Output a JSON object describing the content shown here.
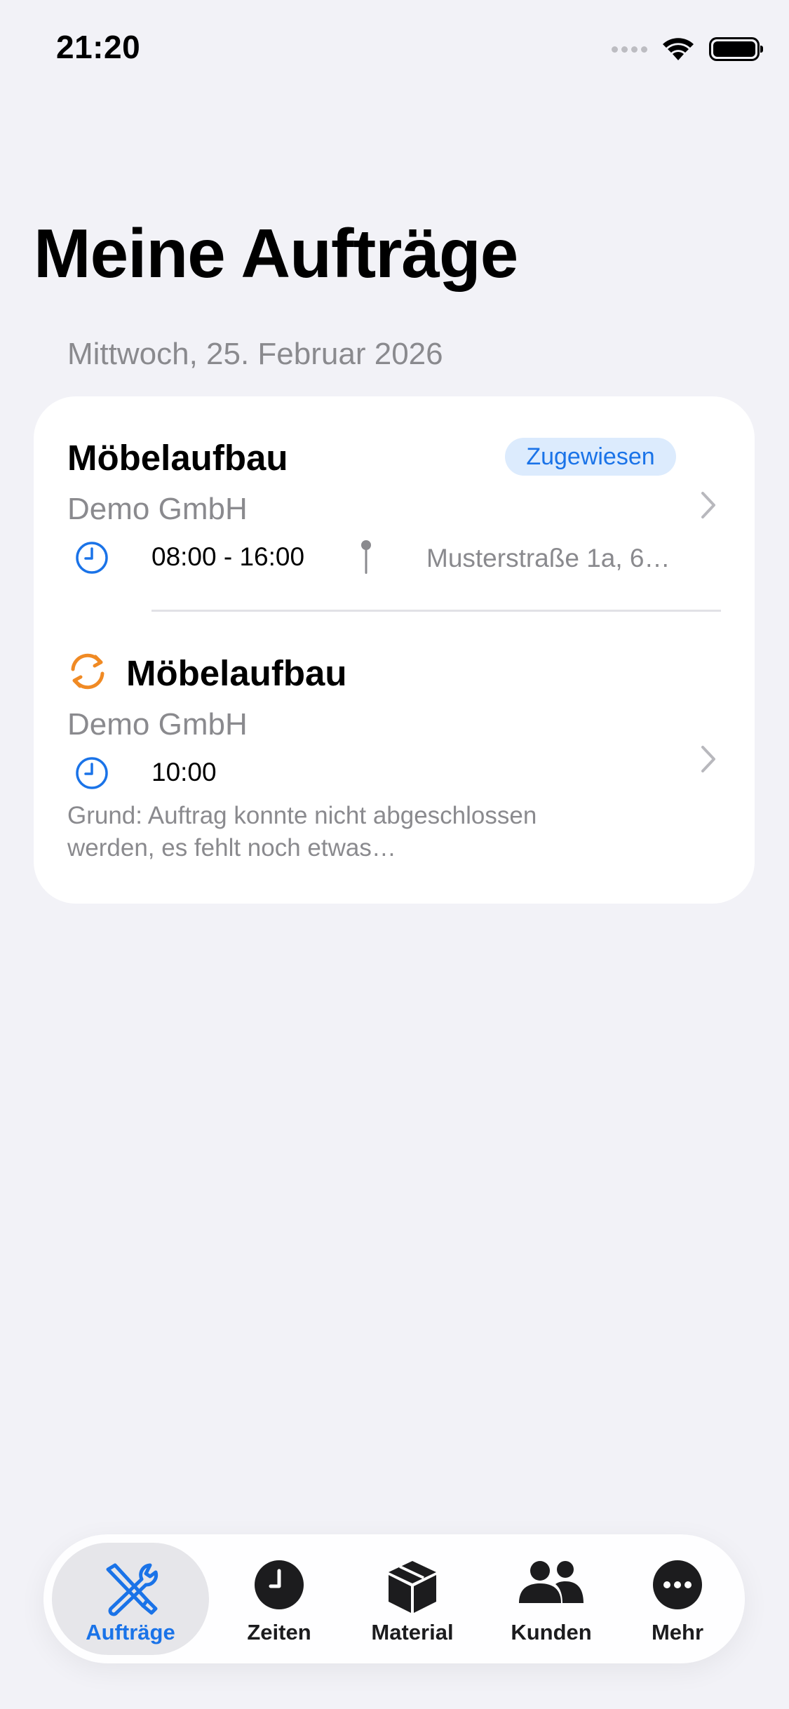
{
  "status_bar": {
    "time": "21:20"
  },
  "header": {
    "title": "Meine Aufträge",
    "date": "Mittwoch, 25. Februar 2026"
  },
  "orders": [
    {
      "title": "Möbelaufbau",
      "status": "Zugewiesen",
      "company": "Demo GmbH",
      "time": "08:00 - 16:00",
      "address": "Musterstraße 1a, 6…",
      "icons": [
        "clock-icon",
        "pin-icon",
        "chevron-right-icon"
      ]
    },
    {
      "title": "Möbelaufbau",
      "company": "Demo GmbH",
      "time": "10:00",
      "reason": "Grund: Auftrag konnte nicht abgeschlossen werden, es fehlt noch etwas…",
      "icons": [
        "sync-icon",
        "clock-icon",
        "chevron-right-icon"
      ]
    }
  ],
  "tabbar": {
    "items": [
      {
        "label": "Aufträge",
        "icon": "tools-icon",
        "active": true
      },
      {
        "label": "Zeiten",
        "icon": "clock-filled-icon",
        "active": false
      },
      {
        "label": "Material",
        "icon": "box-icon",
        "active": false
      },
      {
        "label": "Kunden",
        "icon": "people-icon",
        "active": false
      },
      {
        "label": "Mehr",
        "icon": "more-icon",
        "active": false
      }
    ]
  },
  "colors": {
    "accent": "#1A73E8",
    "badge_bg": "#DCEBFD",
    "warning": "#F08A24",
    "secondary_text": "#8A8A8E",
    "background": "#F2F2F7"
  }
}
